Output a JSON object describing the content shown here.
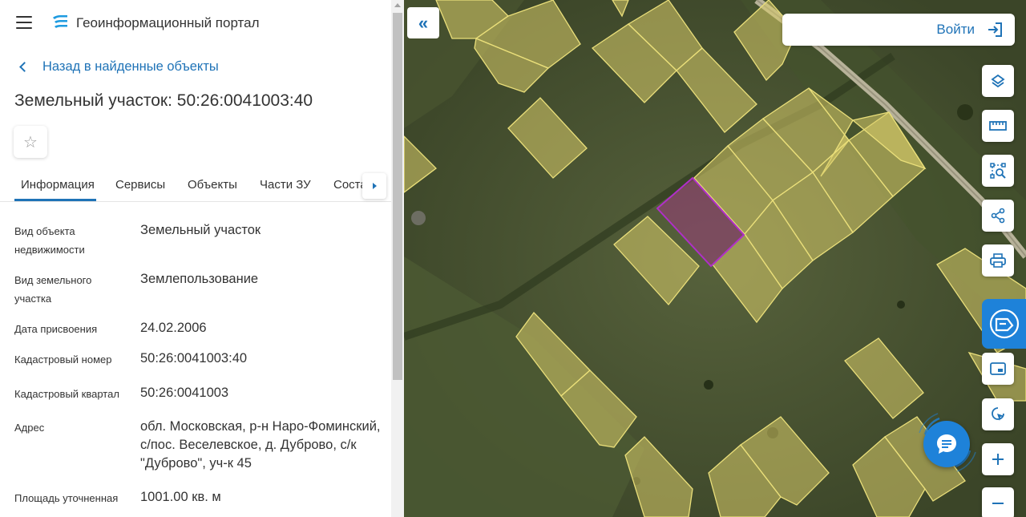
{
  "header": {
    "title": "Геоинформационный портал",
    "menu_icon": "hamburger-icon",
    "logo_icon": "portal-logo-icon"
  },
  "back_link": {
    "label": "Назад в найденные объекты"
  },
  "object_title": "Земельный участок: 50:26:0041003:40",
  "tabs": [
    {
      "label": "Информация",
      "active": true
    },
    {
      "label": "Сервисы",
      "active": false
    },
    {
      "label": "Объекты",
      "active": false
    },
    {
      "label": "Части ЗУ",
      "active": false
    },
    {
      "label": "Соста",
      "active": false
    }
  ],
  "info_rows": [
    {
      "label": "Вид объекта недвижимости",
      "value": "Земельный участок"
    },
    {
      "label": "Вид земельного участка",
      "value": "Землепользование"
    },
    {
      "label": "Дата присвоения",
      "value": "24.02.2006"
    },
    {
      "label": "Кадастровый номер",
      "value": "50:26:0041003:40"
    },
    {
      "label": "Кадастровый квартал",
      "value": "50:26:0041003"
    },
    {
      "label": "Адрес",
      "value": "обл. Московская, р-н Наро-Фоминский, с/пос. Веселевское, д. Дуброво, с/к \"Дуброво\", уч-к 45"
    },
    {
      "label": "Площадь уточненная",
      "value": "1001.00 кв. м"
    }
  ],
  "map": {
    "login_label": "Войти",
    "collapse_icon": "double-chevron-left-icon",
    "tools": [
      "layers-icon",
      "ruler-icon",
      "area-select-icon",
      "share-icon",
      "print-icon",
      "active-tool-icon",
      "minimap-icon",
      "locate-icon",
      "zoom-in-icon",
      "zoom-out-icon"
    ],
    "chat_icon": "chat-icon",
    "colors": {
      "parcel_fill": "#d8cc6a",
      "parcel_stroke": "#eadf7a",
      "selected_stroke": "#b02fc9",
      "accent": "#1f73b7",
      "active_tool": "#1e82d9"
    }
  }
}
